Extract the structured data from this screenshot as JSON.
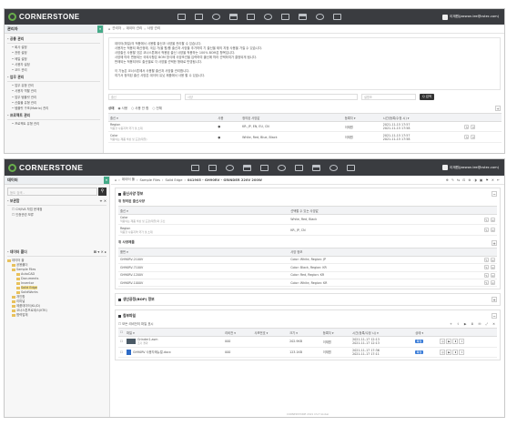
{
  "app": {
    "brand": "CORNERSTONE",
    "user": "이재원(jaewon.lee@cstec.com)"
  },
  "w1": {
    "sidebar": {
      "title": "관리자",
      "sections": [
        {
          "label": "- 공통 관리",
          "items": [
            "회사 설정",
            "권한 설정",
            "메일 설정",
            "사용자 설정",
            "코드 관리"
          ]
        },
        {
          "label": "- 업무 관리",
          "items": [
            "업무 유형 관리",
            "사용자 역할 관리",
            "업무 템플릿 관리",
            "산출물 유형 관리",
            "템플릿 구조(Matrix) 관리"
          ]
        },
        {
          "label": "- 프로젝트 관리",
          "items": [
            "프로젝트 유형 관리"
          ]
        }
      ]
    },
    "breadcrumb": [
      "관리자",
      "데이터 관리",
      "사양 관리"
    ],
    "notes": [
      "데이터(파일)의 적용에서 사용할 출신과 사양을 관리할 수 있습니다.",
      "사용자는 적용되 확산정에, 국입 가/을 원/를 출신과 사양을 추가하여 기 출신을 제의 지정 사용을 가질 수 있습니다.",
      "사양출신 사용할 것은 코너스톤에서 적용된 출신 사양을 적용하는 100% BOM은 항목입니다.",
      "사양에 따라 변동되는 국외사항은 BOM 방식에 사양조건을 입력하여 출신에 따라 선택하여가 결정되게 됩니다.",
      "판매되는 적용되어도 출신별로 각 사양을 선택한 형태로 반영됩니다.",
      "",
      "이 기능은 코너스톤에서 사용할 출신과 사양을 관리합니다.",
      "여기서 정의된 출신 사양은 데이터 유닛 제품에서 사용 할 수 있습니다."
    ],
    "search": {
      "ph1": "출신",
      "ph2": "사양",
      "ph3": "설명조",
      "button": "Q 검색"
    },
    "status": {
      "label": "상태",
      "options": [
        "사용",
        "사용 안 함",
        "전체"
      ]
    },
    "table": {
      "headers": [
        "출신 ▾",
        "사용",
        "정의된 사양값",
        "등록자 ▾",
        "시간(등록/수정 시) ▾"
      ],
      "rows": [
        {
          "name": "Region",
          "sub": "적용할 사용지역 국가 및 소재",
          "use": "●",
          "spec": "KR, JP, EN, EU, CN",
          "by": "이재원",
          "time": "2021-11-15 17:57\n2021-11-15 17:58"
        },
        {
          "name": "Color",
          "sub": "적용되는 제품 색상 및 도장(재질)",
          "use": "●",
          "spec": "White, Red, Blue, Black",
          "by": "이재원",
          "time": "2021-11-15 17:57\n2021-11-15 17:58"
        }
      ]
    }
  },
  "w2": {
    "sidebar": {
      "title": "데이터",
      "search_ph": "등도 검색 -",
      "bookmark": {
        "label": "- 보관함",
        "items": [
          "CH/IVA 작업 문제점",
          "인증관련 보류"
        ]
      },
      "folders_label": "- 데이터 폴더",
      "tree": [
        {
          "t": "데이터 홀",
          "d": 0
        },
        {
          "t": "공용폴더",
          "d": 1
        },
        {
          "t": "Sample Files",
          "d": 1
        },
        {
          "t": "AutoCAD",
          "d": 2
        },
        {
          "t": "Documents",
          "d": 2
        },
        {
          "t": "Inventor",
          "d": 2
        },
        {
          "t": "Solid Edge",
          "d": 2,
          "hl": true
        },
        {
          "t": "SolidWorks",
          "d": 2
        },
        {
          "t": "개인함",
          "d": 1
        },
        {
          "t": "리피널",
          "d": 1
        },
        {
          "t": "제품데이터(KL/D)",
          "d": 1
        },
        {
          "t": "코너스톤프로세스(KTK)",
          "d": 1
        },
        {
          "t": "협력업체",
          "d": 1
        }
      ]
    },
    "breadcrumb": [
      "데이터 폴",
      "Sample Files",
      "Solid Edge",
      "041905 - GH90RV - GRINDER 220V 200W"
    ],
    "spec_title": "출신사양 정보",
    "defined_title": "위 정의된 출신사양",
    "defined_headers": [
      "출신 ▾",
      "선택할 수 있는 사양값"
    ],
    "defined_rows": [
      {
        "name": "Color",
        "sub": "적용되는 제품 색상 및 도장(재질)의 출신",
        "val": "White, Red, Black"
      },
      {
        "name": "Region",
        "sub": "적용할 사용지역 국가 및 소재",
        "val": "KR, JP, CN"
      }
    ],
    "variant_title": "위 사양제품",
    "variant_headers": [
      "품번 ▾",
      "사양 정보"
    ],
    "variant_rows": [
      {
        "pn": "GH90RV-2100V",
        "info": "Color: White, Region: JP"
      },
      {
        "pn": "GH90RV-7100V",
        "info": "Color: Black, Region: KR"
      },
      {
        "pn": "GH90RV-1200V",
        "info": "Color: Red, Region: KR"
      },
      {
        "pn": "GH90RV-1000V",
        "info": "Color: White, Region: KR"
      }
    ],
    "bop_title": "생산공정(BOP) 정보",
    "attach_title": "첨부파일",
    "attach_check": "모든 리비전의 파일 표시",
    "attach_headers": [
      "파일 ▾",
      "리비전 ▾",
      "사포번호 ▾",
      "크기 ▾",
      "등록자 ▾",
      "시간(등록/수정 시) ▾",
      "상태 ▾"
    ],
    "attach_rows": [
      {
        "name": "Grinder1.asm",
        "sub": "조기 결과",
        "rev": "000",
        "size": "202.9KB",
        "by": "이재원",
        "time": "2021-11-17 12:13\n2021-11-17 12:13",
        "st": "확정"
      },
      {
        "name": "GH90RV 사용자매뉴얼.docx",
        "sub": "",
        "rev": "000",
        "size": "123.1KB",
        "by": "이재원",
        "time": "2021-11-17 17:36\n2021-11-17 17:11",
        "st": "확정"
      }
    ],
    "footer": "CORNERSTONE 2021 CS-T Global"
  }
}
